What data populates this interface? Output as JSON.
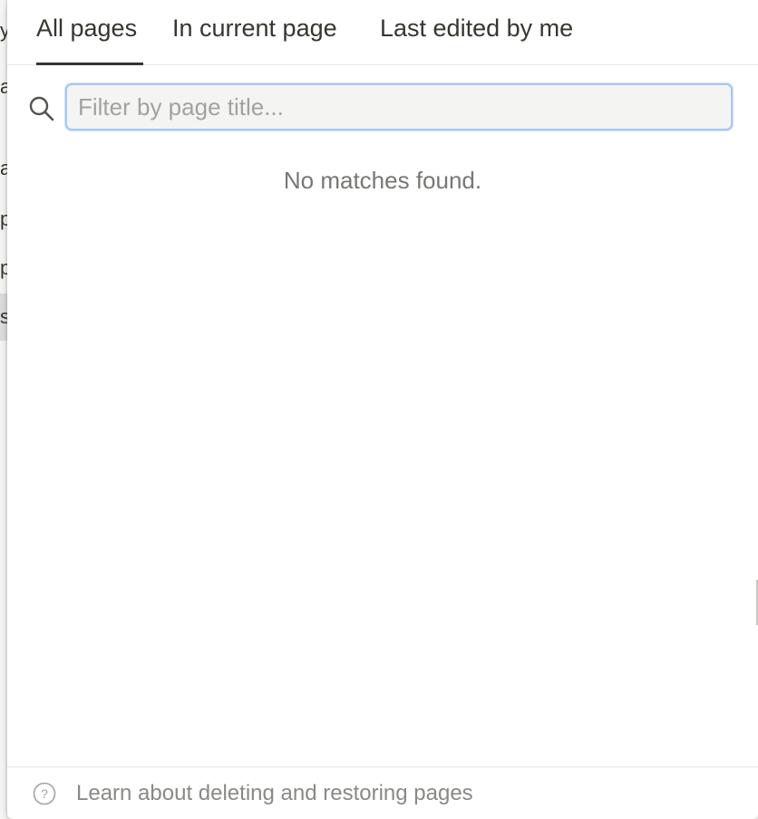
{
  "background": {
    "fragments": [
      "y",
      "a",
      "a",
      "p",
      "p",
      "s"
    ]
  },
  "tabs": [
    {
      "label": "All pages",
      "active": true
    },
    {
      "label": "In current page",
      "active": false
    },
    {
      "label": "Last edited by me",
      "active": false
    }
  ],
  "search": {
    "value": "",
    "placeholder": "Filter by page title...",
    "icon": "search-icon"
  },
  "results": {
    "empty_message": "No matches found."
  },
  "footer": {
    "icon": "help-circle-icon",
    "link_text": "Learn about deleting and restoring pages"
  },
  "colors": {
    "text": "#37352f",
    "muted": "#787774",
    "focus_ring": "#a8c8f0",
    "input_bg": "#f4f4f3"
  }
}
